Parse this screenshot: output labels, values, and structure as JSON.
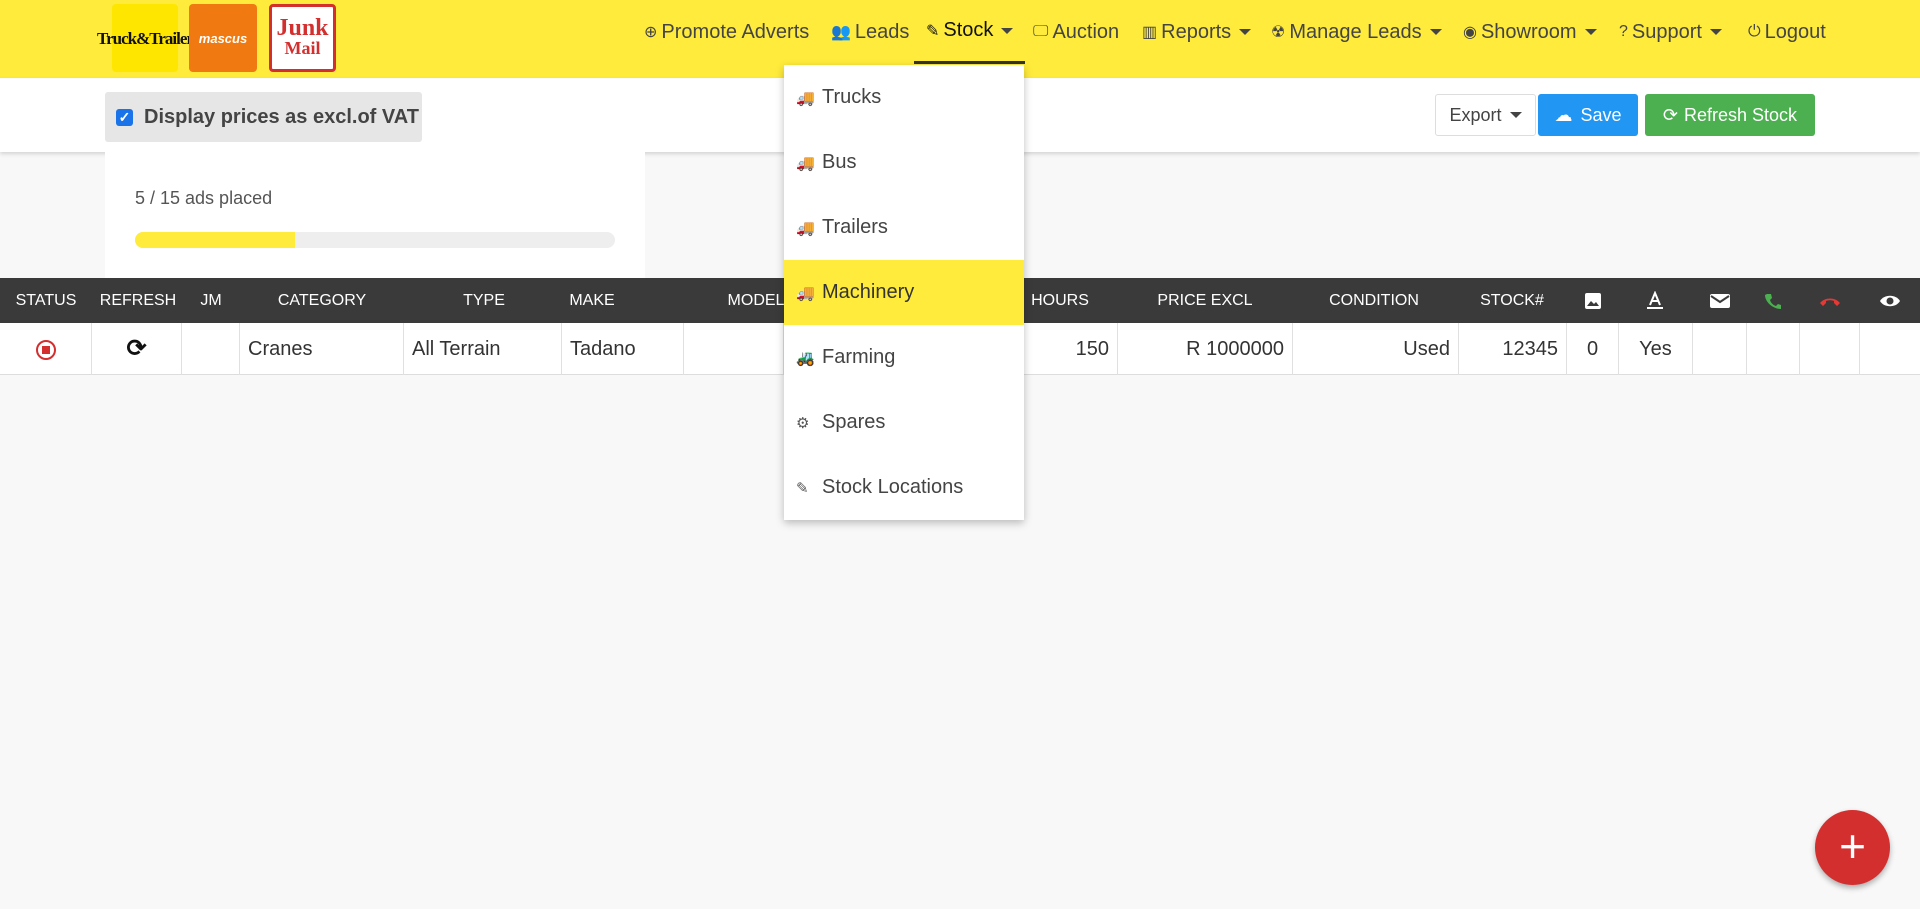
{
  "logos": {
    "truck_trailer": "Truck&Trailer",
    "mascus": "mascus",
    "junk_mail_top": "Junk",
    "junk_mail_bottom": "Mail"
  },
  "nav": {
    "promote": "Promote Adverts",
    "leads": "Leads",
    "stock": "Stock",
    "auction": "Auction",
    "reports": "Reports",
    "manage_leads": "Manage Leads",
    "showroom": "Showroom",
    "support": "Support",
    "logout": "Logout"
  },
  "toolbar": {
    "vat_label": "Display prices as excl.of VAT",
    "vat_checked": true,
    "export_label": "Export",
    "save_label": "Save",
    "refresh_label": "Refresh Stock"
  },
  "ads": {
    "label": "5 / 15 ads placed",
    "placed": 5,
    "total": 15
  },
  "table": {
    "headers": [
      "STATUS",
      "REFRESH",
      "JM",
      "CATEGORY",
      "TYPE",
      "MAKE",
      "MODEL",
      "HOURS",
      "PRICE EXCL",
      "CONDITION",
      "STOCK#"
    ],
    "row": {
      "category": "Cranes",
      "type": "All Terrain",
      "make": "Tadano",
      "hours": "150",
      "price": "R 1000000",
      "condition": "Used",
      "stock_no": "12345",
      "images": "0",
      "flag": "Yes"
    }
  },
  "stock_menu": {
    "items": [
      "Trucks",
      "Bus",
      "Trailers",
      "Machinery",
      "Farming",
      "Spares",
      "Stock Locations"
    ],
    "highlighted": "Machinery"
  },
  "colors": {
    "brand_yellow": "#ffeb3b",
    "save_blue": "#2196f3",
    "refresh_green": "#4caf50",
    "fab_red": "#d32f2f"
  }
}
